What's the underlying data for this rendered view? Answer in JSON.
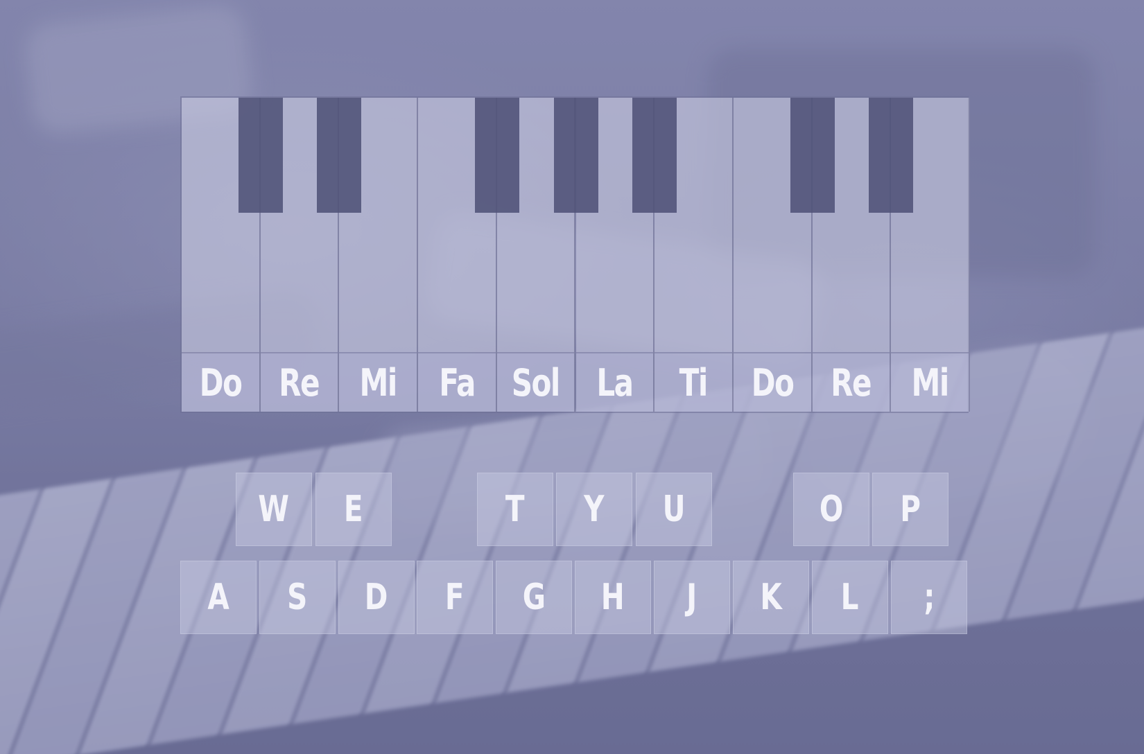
{
  "colors": {
    "background": "#7d7fa6",
    "white_key": "#c8cae1",
    "black_key": "#505278",
    "label_text": "#f4f4fa"
  },
  "piano": {
    "notes": [
      "Do",
      "Re",
      "Mi",
      "Fa",
      "Sol",
      "La",
      "Ti",
      "Do",
      "Re",
      "Mi"
    ],
    "black_keys_after_white_index": [
      0,
      1,
      3,
      4,
      5,
      7,
      8
    ]
  },
  "keyboard": {
    "upper_row": [
      "W",
      "E",
      "T",
      "Y",
      "U",
      "O",
      "P"
    ],
    "lower_row": [
      "A",
      "S",
      "D",
      "F",
      "G",
      "H",
      "J",
      "K",
      "L",
      ";"
    ]
  }
}
